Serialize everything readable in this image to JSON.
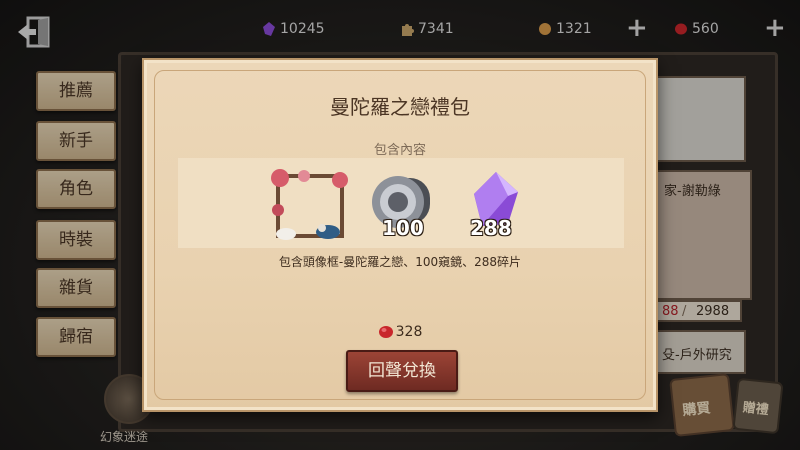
{
  "resources": {
    "crystal": "10245",
    "puzzle": "7341",
    "clue": "1321",
    "echo": "560"
  },
  "tabs": [
    {
      "label": "推薦"
    },
    {
      "label": "新手"
    },
    {
      "label": "角色"
    },
    {
      "label": "時裝"
    },
    {
      "label": "雜貨"
    },
    {
      "label": "歸宿"
    }
  ],
  "right_cards": {
    "card2_text": "家-謝勒綠",
    "card3_price_left": "88",
    "card3_price_right": "2988",
    "card4_text": "殳-戶外研究"
  },
  "bottom": {
    "label": "幻象迷途",
    "shop_label": "購買",
    "gift_label": "贈禮"
  },
  "dialog": {
    "title": "曼陀羅之戀禮包",
    "subtitle": "包含內容",
    "items": [
      {
        "icon": "portrait-frame-icon",
        "qty": ""
      },
      {
        "icon": "telescope-icon",
        "qty": "100"
      },
      {
        "icon": "crystal-fragment-icon",
        "qty": "288"
      }
    ],
    "description": "包含頭像框-曼陀羅之戀、100窺鏡、288碎片",
    "price": "328",
    "redeem_label": "回聲兌換"
  },
  "colors": {
    "dialog_bg": "#ecd7b8",
    "button_red": "#8a3a2e",
    "crystal_purple": "#8a4bd6",
    "echo_red": "#c8262b"
  }
}
